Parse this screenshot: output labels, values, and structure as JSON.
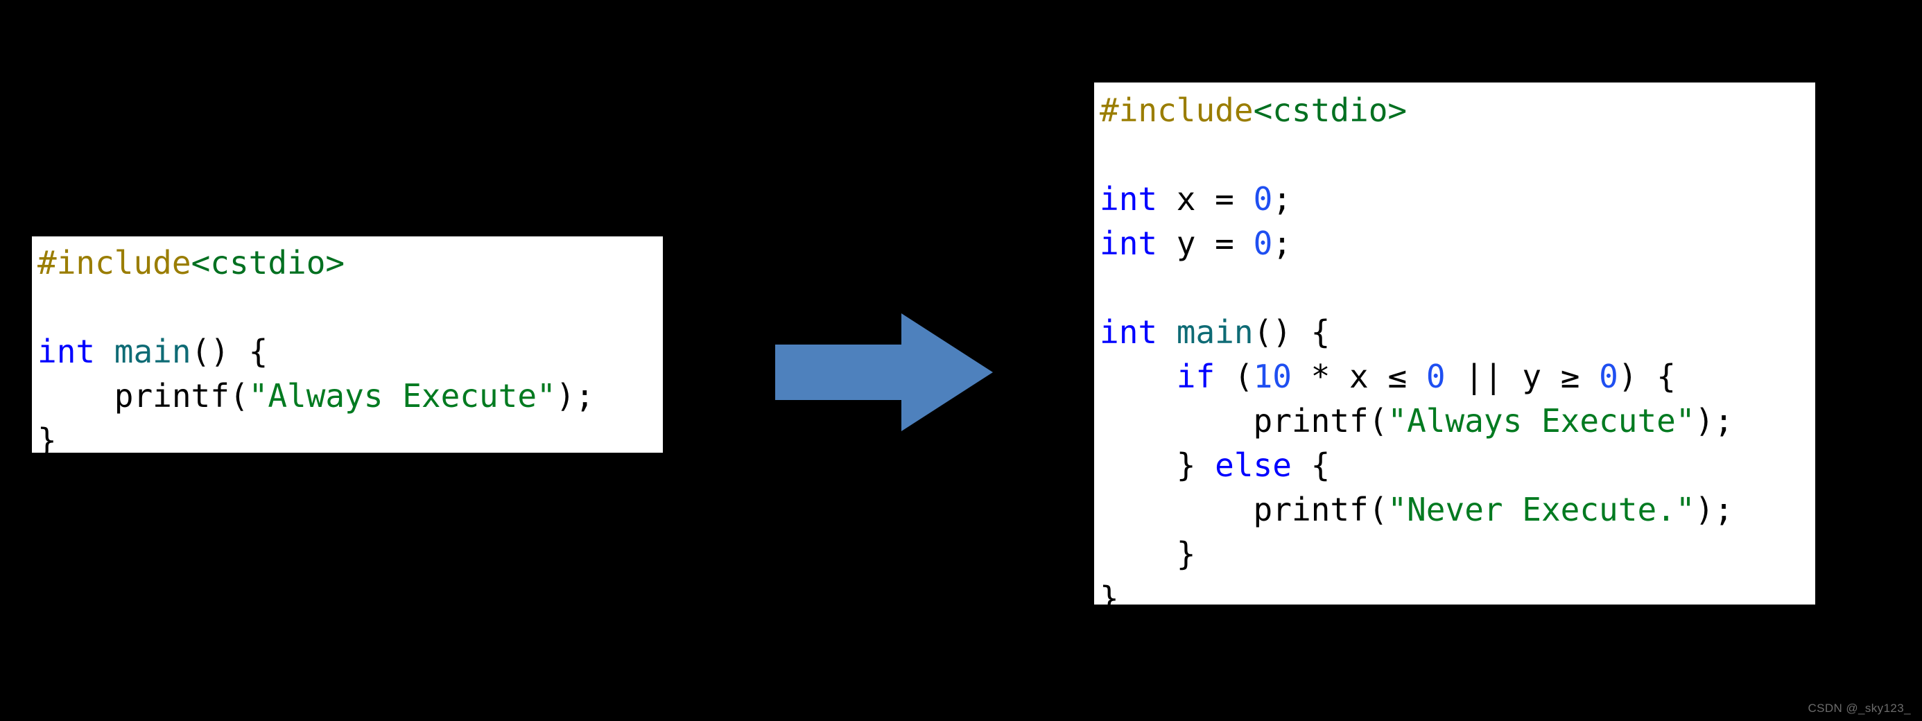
{
  "background_color": "#000000",
  "panels": {
    "before": {
      "name": "original-code-snippet",
      "background": "#ffffff",
      "lines": [
        [
          {
            "text": "#include",
            "cls": "tok-preproc"
          },
          {
            "text": "<cstdio>",
            "cls": "tok-header"
          }
        ],
        [
          {
            "text": "",
            "cls": "tok-plain"
          }
        ],
        [
          {
            "text": "int",
            "cls": "tok-keyword"
          },
          {
            "text": " ",
            "cls": "tok-plain"
          },
          {
            "text": "main",
            "cls": "tok-function"
          },
          {
            "text": "() {",
            "cls": "tok-plain"
          }
        ],
        [
          {
            "text": "    printf(",
            "cls": "tok-plain"
          },
          {
            "text": "\"Always Execute\"",
            "cls": "tok-string"
          },
          {
            "text": ");",
            "cls": "tok-plain"
          }
        ],
        [
          {
            "text": "}",
            "cls": "tok-plain"
          }
        ]
      ],
      "plain_text": "#include<cstdio>\n\nint main() {\n    printf(\"Always Execute\");\n}"
    },
    "after": {
      "name": "transformed-code-snippet",
      "background": "#ffffff",
      "lines": [
        [
          {
            "text": "#include",
            "cls": "tok-preproc"
          },
          {
            "text": "<cstdio>",
            "cls": "tok-header"
          }
        ],
        [
          {
            "text": "",
            "cls": "tok-plain"
          }
        ],
        [
          {
            "text": "int",
            "cls": "tok-keyword"
          },
          {
            "text": " x = ",
            "cls": "tok-plain"
          },
          {
            "text": "0",
            "cls": "tok-number"
          },
          {
            "text": ";",
            "cls": "tok-plain"
          }
        ],
        [
          {
            "text": "int",
            "cls": "tok-keyword"
          },
          {
            "text": " y = ",
            "cls": "tok-plain"
          },
          {
            "text": "0",
            "cls": "tok-number"
          },
          {
            "text": ";",
            "cls": "tok-plain"
          }
        ],
        [
          {
            "text": "",
            "cls": "tok-plain"
          }
        ],
        [
          {
            "text": "int",
            "cls": "tok-keyword"
          },
          {
            "text": " ",
            "cls": "tok-plain"
          },
          {
            "text": "main",
            "cls": "tok-function"
          },
          {
            "text": "() {",
            "cls": "tok-plain"
          }
        ],
        [
          {
            "text": "    ",
            "cls": "tok-plain"
          },
          {
            "text": "if",
            "cls": "tok-keyword"
          },
          {
            "text": " (",
            "cls": "tok-plain"
          },
          {
            "text": "10",
            "cls": "tok-number"
          },
          {
            "text": " * x ",
            "cls": "tok-plain"
          },
          {
            "text": "≤",
            "cls": "tok-op"
          },
          {
            "text": " ",
            "cls": "tok-plain"
          },
          {
            "text": "0",
            "cls": "tok-number"
          },
          {
            "text": " || y ",
            "cls": "tok-plain"
          },
          {
            "text": "≥",
            "cls": "tok-op"
          },
          {
            "text": " ",
            "cls": "tok-plain"
          },
          {
            "text": "0",
            "cls": "tok-number"
          },
          {
            "text": ") {",
            "cls": "tok-plain"
          }
        ],
        [
          {
            "text": "        printf(",
            "cls": "tok-plain"
          },
          {
            "text": "\"Always Execute\"",
            "cls": "tok-string"
          },
          {
            "text": ");",
            "cls": "tok-plain"
          }
        ],
        [
          {
            "text": "    } ",
            "cls": "tok-plain"
          },
          {
            "text": "else",
            "cls": "tok-keyword"
          },
          {
            "text": " {",
            "cls": "tok-plain"
          }
        ],
        [
          {
            "text": "        printf(",
            "cls": "tok-plain"
          },
          {
            "text": "\"Never Execute.\"",
            "cls": "tok-string"
          },
          {
            "text": ");",
            "cls": "tok-plain"
          }
        ],
        [
          {
            "text": "    }",
            "cls": "tok-plain"
          }
        ],
        [
          {
            "text": "}",
            "cls": "tok-plain"
          }
        ]
      ],
      "plain_text": "#include<cstdio>\n\nint x = 0;\nint y = 0;\n\nint main() {\n    if (10 * x <= 0 || y >= 0) {\n        printf(\"Always Execute\");\n    } else {\n        printf(\"Never Execute.\");\n    }\n}"
    }
  },
  "arrow": {
    "label": "transform-arrow",
    "color": "#4e81bd",
    "direction": "right"
  },
  "watermark": {
    "text": "CSDN @_sky123_",
    "color": "#6b6b6b"
  },
  "syntax_colors": {
    "preprocessor": "#9a7d00",
    "header": "#007020",
    "keyword": "#0000ff",
    "function": "#0e6b75",
    "string": "#007a20",
    "number": "#1f4ff1",
    "plain": "#000000"
  }
}
